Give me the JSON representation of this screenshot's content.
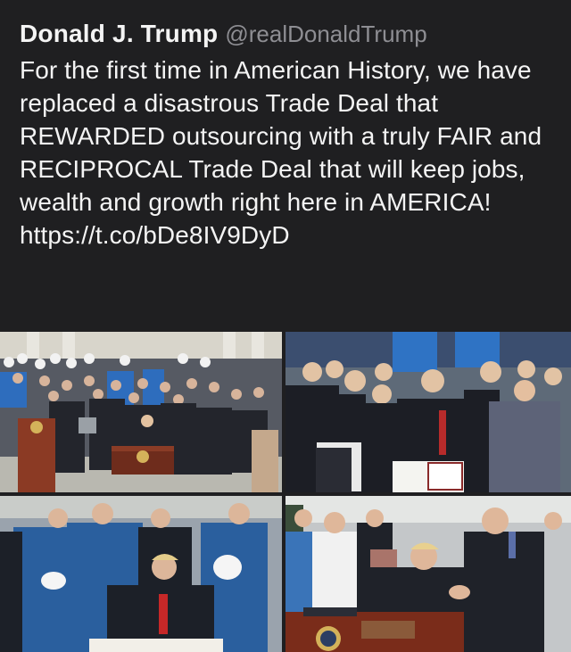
{
  "tweet": {
    "author_name": "Donald J. Trump",
    "author_handle": "@realDonaldTrump",
    "text": "For the first time in American History, we have replaced a disastrous Trade Deal that REWARDED outsourcing with a truly FAIR and RECIPROCAL Trade Deal that will keep jobs, wealth and growth right here in AMERICA! https://t.co/bDe8IV9DyD"
  },
  "media": {
    "photos": [
      {
        "icon": "photo-signing-ceremony-crowd"
      },
      {
        "icon": "photo-signed-document-group"
      },
      {
        "icon": "photo-signing-at-desk-workers"
      },
      {
        "icon": "photo-handshake-at-desk"
      }
    ]
  },
  "colors": {
    "background": "#1f1f21",
    "text": "#f4f4f4",
    "handle": "#8e8e93"
  }
}
